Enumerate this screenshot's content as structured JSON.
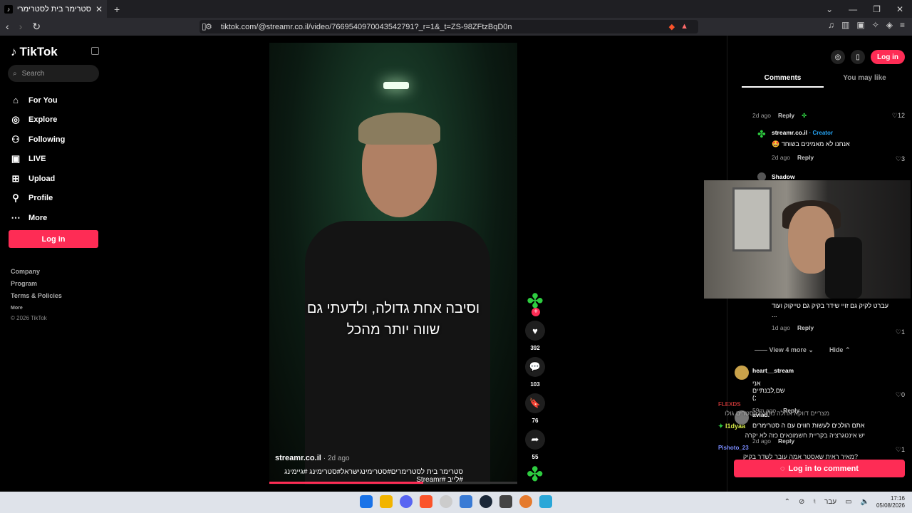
{
  "browser": {
    "tab_title": "סטרימר בית לסטרימרים #סטרי...",
    "tab_favicon": "tiktok-icon",
    "url": "tiktok.com/@streamr.co.il/video/7669540970043542791?_r=1&_t=ZS-98ZFtzBqD0n"
  },
  "sidebar": {
    "brand": "TikTok",
    "search_placeholder": "Search",
    "items": [
      {
        "label": "For You",
        "icon": "home-icon"
      },
      {
        "label": "Explore",
        "icon": "compass-icon"
      },
      {
        "label": "Following",
        "icon": "following-icon"
      },
      {
        "label": "LIVE",
        "icon": "live-icon"
      },
      {
        "label": "Upload",
        "icon": "upload-icon"
      },
      {
        "label": "Profile",
        "icon": "profile-icon"
      },
      {
        "label": "More",
        "icon": "more-icon"
      }
    ],
    "login_label": "Log in",
    "footer": [
      "Company",
      "Program",
      "Terms & Policies"
    ],
    "footer_more": "More",
    "copyright": "© 2026 TikTok"
  },
  "video": {
    "caption_line1": "וסיבה אחת גדולה, ולדעתי גם",
    "caption_line2": "שווה יותר מהכל",
    "author": "streamr.co.il",
    "time": "· 2d ago",
    "tags": "סטרימר בית לסטרימרים#סטרימינגישראל#סטרימינג #גיימינג #לייב #Streamr",
    "progress": 0.62
  },
  "actions": {
    "likes": "392",
    "comments": "103",
    "saves": "76",
    "shares": "55"
  },
  "right_panel": {
    "login_label": "Log in",
    "tab_comments": "Comments",
    "tab_may_like": "You may like",
    "c0_meta_time": "2d ago",
    "c0_reply": "Reply",
    "c0_likes": "12",
    "c1_user": "streamr.co.il",
    "c1_badge": "· Creator",
    "c1_text": "אנחנו לא מאמינים בשוחד 🤩",
    "c1_time": "2d ago",
    "c1_reply": "Reply",
    "c1_likes": "3",
    "c2_user": "Shadow",
    "c3_text1": "עברט לקיק גם זויי שידר בקיק גם טייקוק ועוד",
    "c3_text2": "...",
    "c3_time": "1d ago",
    "c3_reply": "Reply",
    "c3_likes": "1",
    "view_more": "View 4 more",
    "hide": "Hide",
    "c4_user": "heart__stream",
    "c4_text": "אני שם,לבנתיים ;)",
    "c4_time": "59m ago",
    "c4_reply": "Reply",
    "c4_likes": "0",
    "c5_user": "aviad.",
    "c5_text": "אתם הולכים לעשות חווים עם ה סטרימרים",
    "c5_time": "2d ago",
    "c5_reply": "Reply",
    "c5_likes": "1",
    "login_comment": "Log in to comment"
  },
  "chat_overlay": {
    "user1": "FLEXDS",
    "msg1": "מצריים דווקא אחלה מדינה לסטרים גולו",
    "user2": "I1dyaa",
    "msg2": "יש אינטגרציה בקריית חשמונאים כזה לא יקרה",
    "user3": "Pishoto_23",
    "msg3": "?מאיר ראית שאסטר אמה עובר לשדר בקיק"
  },
  "taskbar": {
    "lang": "עבר",
    "time": "17:16",
    "date": "05/08/2026"
  }
}
